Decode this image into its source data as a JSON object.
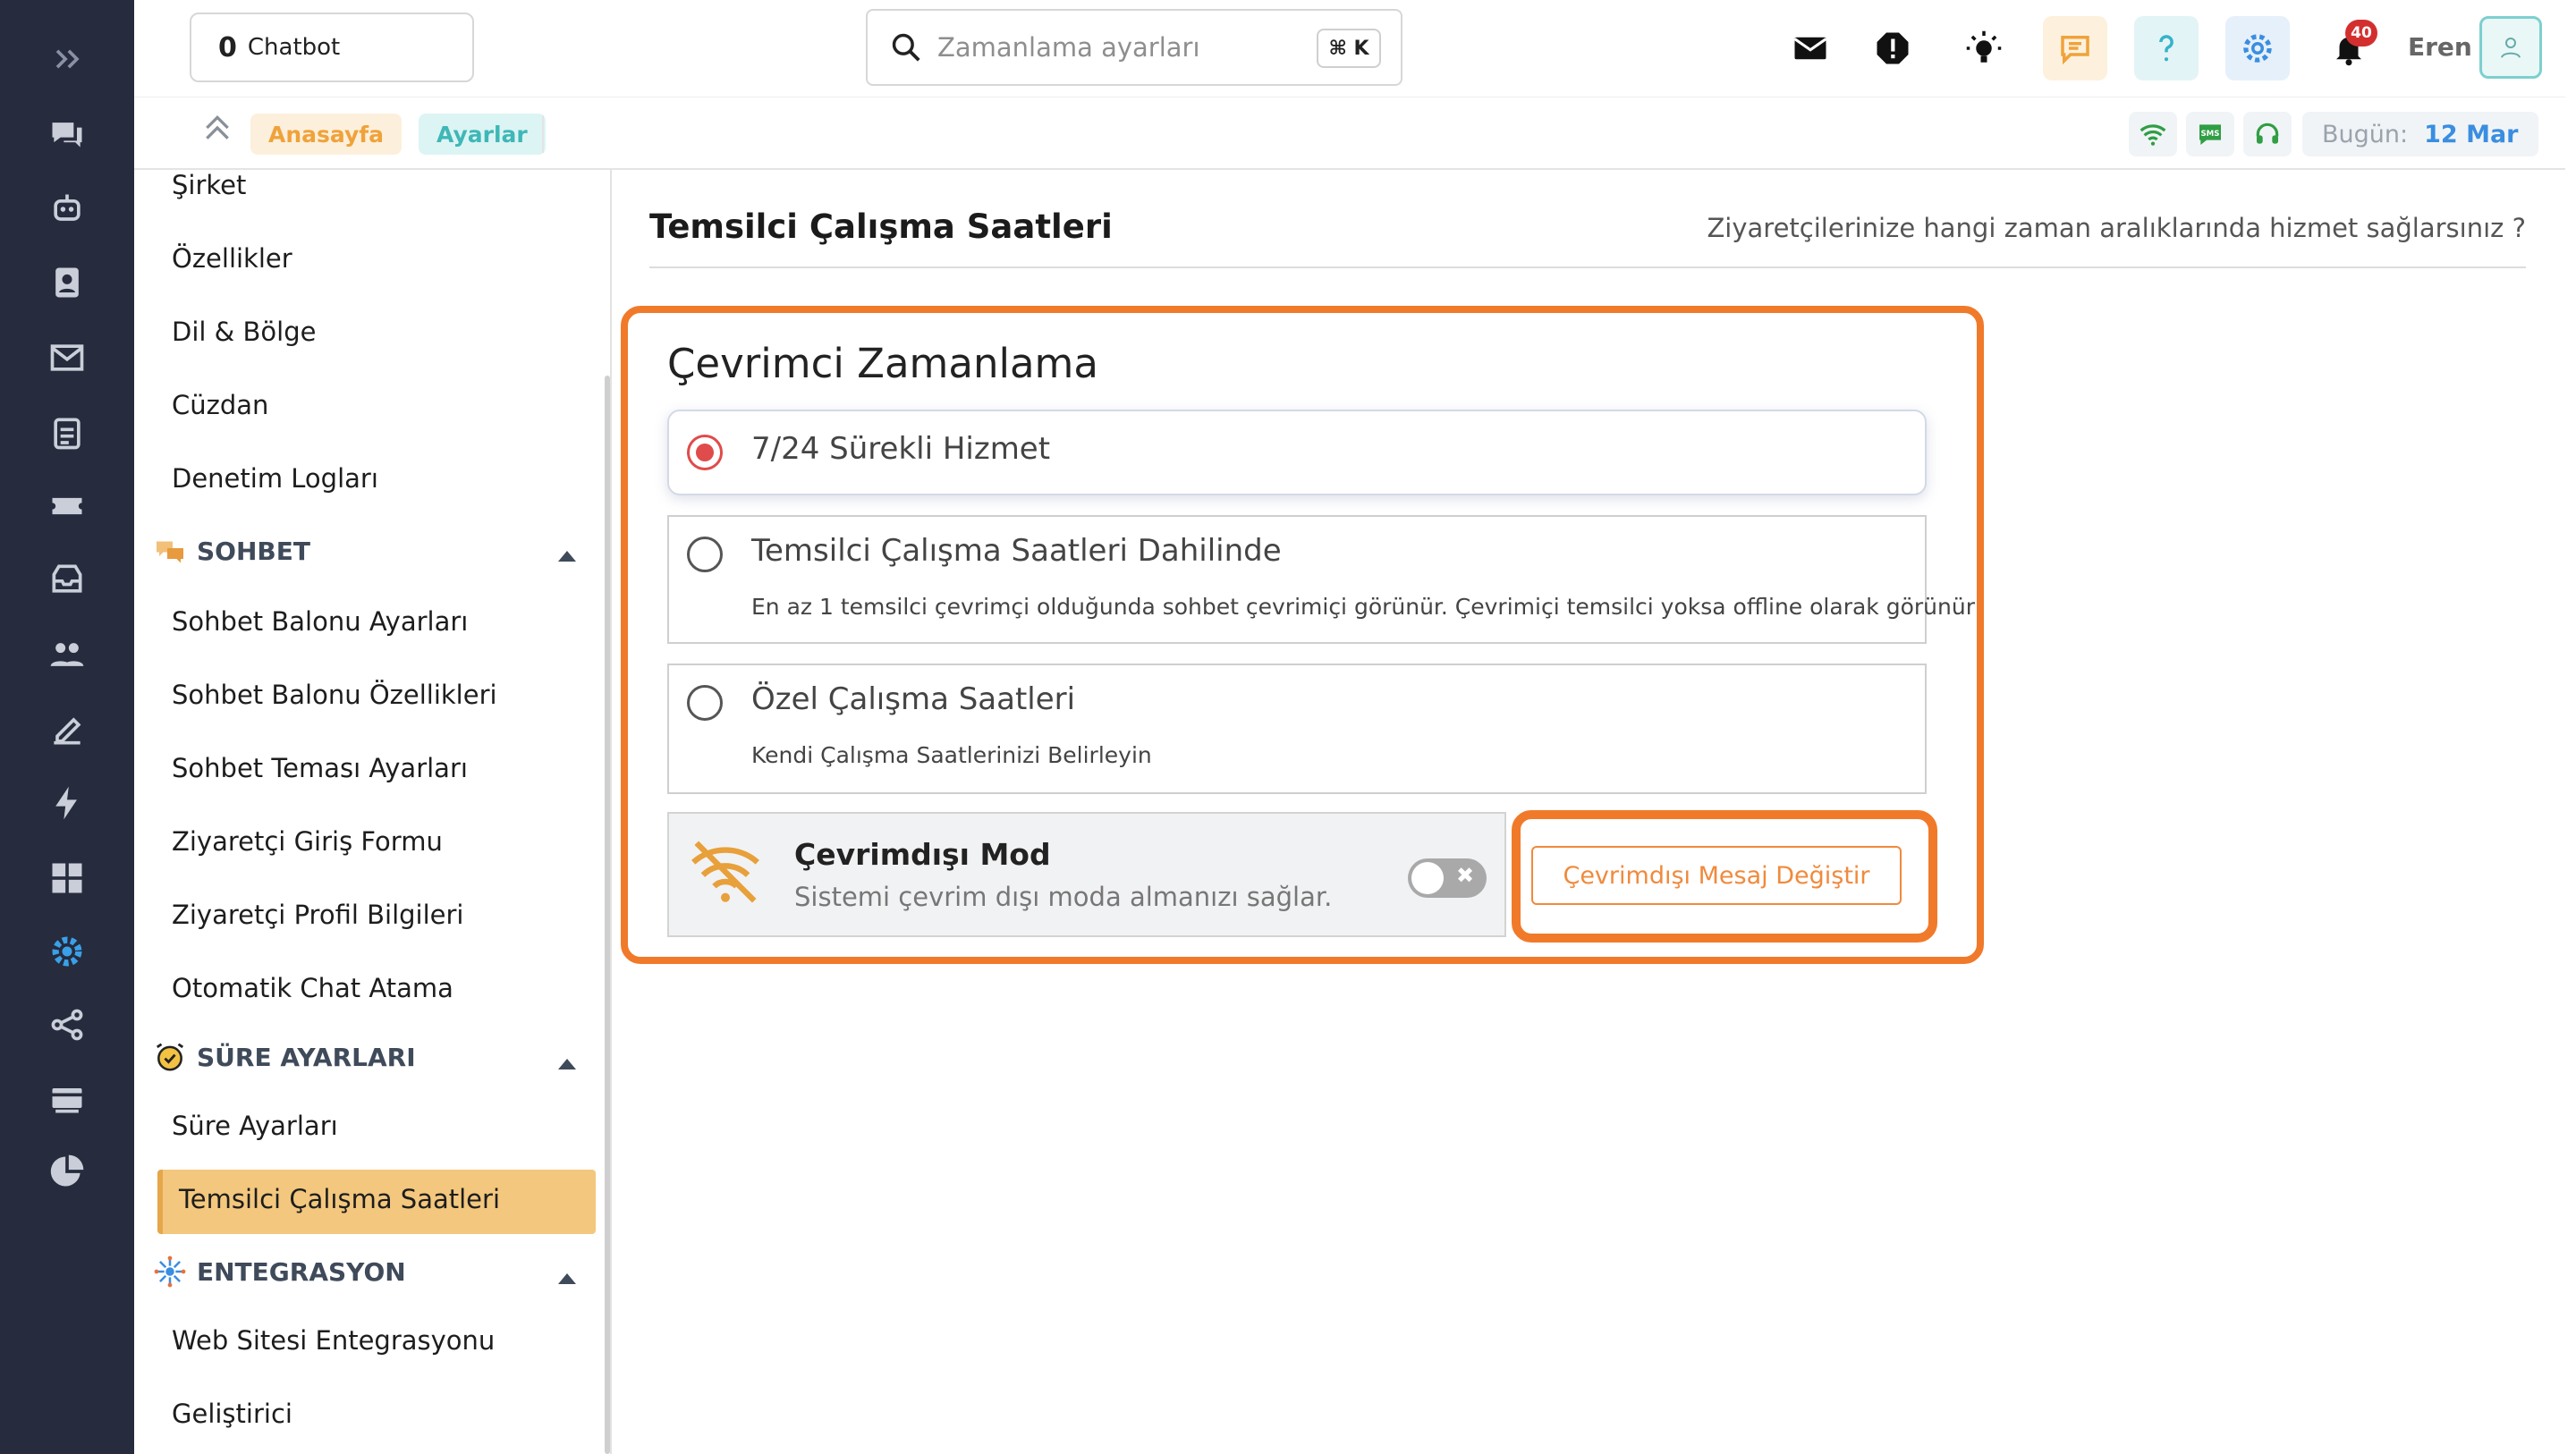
{
  "topbar": {
    "chatbot_count": "0",
    "chatbot_label": "Chatbot",
    "search_placeholder": "Zamanlama ayarları",
    "search_shortcut": "⌘ K",
    "notification_count": "40",
    "user_name": "Eren"
  },
  "breadcrumb": {
    "home": "Anasayfa",
    "settings": "Ayarlar"
  },
  "status": {
    "today_label": "Bugün:",
    "today_value": "12 Mar",
    "sms_label": "SMS"
  },
  "sidebar": {
    "items_top": [
      "Şirket",
      "Özellikler",
      "Dil & Bölge",
      "Cüzdan",
      "Denetim Logları"
    ],
    "sections": [
      {
        "title": "SOHBET",
        "items": [
          "Sohbet Balonu Ayarları",
          "Sohbet Balonu Özellikleri",
          "Sohbet Teması Ayarları",
          "Ziyaretçi Giriş Formu",
          "Ziyaretçi Profil Bilgileri",
          "Otomatik Chat Atama"
        ]
      },
      {
        "title": "SÜRE AYARLARI",
        "items": [
          "Süre Ayarları",
          "Temsilci Çalışma Saatleri"
        ]
      },
      {
        "title": "ENTEGRASYON",
        "items": [
          "Web Sitesi Entegrasyonu",
          "Geliştirici"
        ]
      }
    ],
    "active_item": "Temsilci Çalışma Saatleri"
  },
  "main": {
    "title": "Temsilci Çalışma Saatleri",
    "subtitle": "Ziyaretçilerinize hangi zaman aralıklarında hizmet sağlarsınız ?",
    "card_title": "Çevrimci Zamanlama",
    "options": [
      {
        "title": "7/24 Sürekli Hizmet",
        "desc": "",
        "selected": true
      },
      {
        "title": "Temsilci Çalışma Saatleri Dahilinde",
        "desc": "En az 1 temsilci çevrimçi olduğunda sohbet çevrimiçi görünür. Çevrimiçi temsilci yoksa offline olarak görünür",
        "selected": false
      },
      {
        "title": "Özel Çalışma Saatleri",
        "desc": "Kendi Çalışma Saatlerinizi Belirleyin",
        "selected": false
      }
    ],
    "offline": {
      "title": "Çevrimdışı Mod",
      "desc": "Sistemi çevrim dışı moda almanızı sağlar.",
      "enabled": false
    },
    "offline_message_button": "Çevrimdışı Mesaj Değiştir"
  },
  "colors": {
    "rail_bg": "#262b3d",
    "highlight_orange": "#f07a2a",
    "active_item_bg": "#f3c77d",
    "radio_selected": "#e04b4b",
    "accent_blue": "#3a8ee0"
  }
}
